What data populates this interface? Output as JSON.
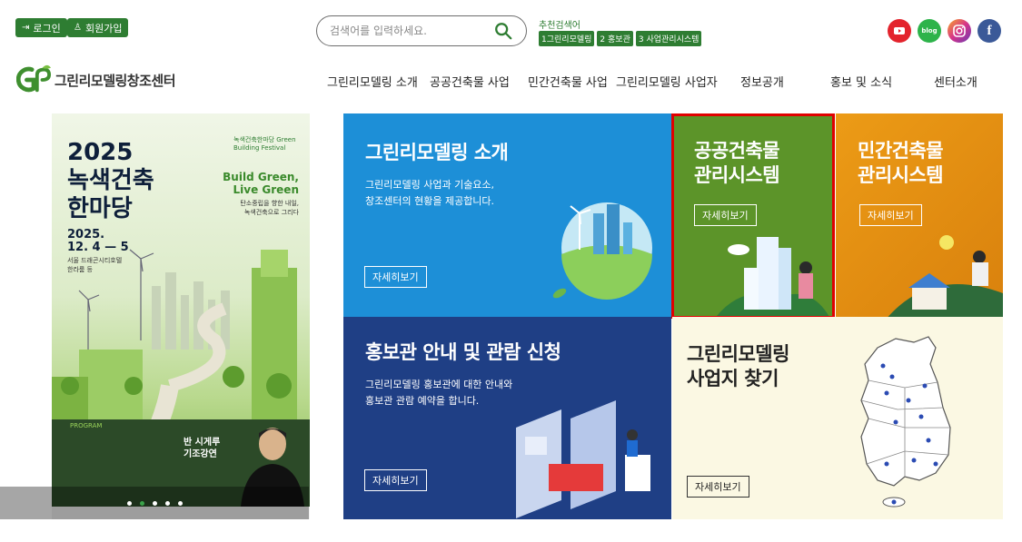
{
  "header": {
    "login_label": "로그인",
    "signup_label": "회원가입",
    "search": {
      "placeholder": "검색어를 입력하세요."
    },
    "recommended": {
      "label": "추천검색어",
      "tags": [
        "1그린리모델링",
        "2 홍보관",
        "3 사업관리시스템"
      ]
    },
    "social": [
      {
        "name": "youtube",
        "glyph": "▶",
        "color": "#e3232c"
      },
      {
        "name": "blog",
        "glyph": "blog",
        "color": "#2db34a"
      },
      {
        "name": "instagram",
        "glyph": "◎",
        "color": "#d6338a"
      },
      {
        "name": "facebook",
        "glyph": "f",
        "color": "#3b5998"
      }
    ]
  },
  "logo": {
    "text": "그린리모델링창조센터"
  },
  "nav": [
    "그린리모델링 소개",
    "공공건축물 사업",
    "민간건축물 사업",
    "그린리모델링 사업자",
    "정보공개",
    "홍보 및 소식",
    "센터소개"
  ],
  "poster": {
    "title_lines": [
      "2025",
      "녹색건축",
      "한마당"
    ],
    "fest_label": "녹색건축한마당 Green Building Festival",
    "slogan_lines": [
      "Build Green,",
      "Live Green"
    ],
    "sub_lines": [
      "탄소중립을 향한 내일,",
      "녹색건축으로 그리다"
    ],
    "date_lines": [
      "2025.",
      "12. 4 — 5"
    ],
    "venue_lines": [
      "서울 드래곤시티호텔",
      "한라룸 등"
    ],
    "program_label": "PROGRAM",
    "speaker_lines": [
      "반 시게루",
      "기조강연"
    ]
  },
  "pager": {
    "dots": 5,
    "active": 1
  },
  "tiles": {
    "intro": {
      "title": "그린리모델링 소개",
      "desc_lines": [
        "그린리모델링 사업과 기술요소,",
        "창조센터의 현황을 제공합니다."
      ],
      "button": "자세히보기"
    },
    "public": {
      "title_lines": [
        "공공건축물",
        "관리시스템"
      ],
      "button": "자세히보기"
    },
    "private": {
      "title_lines": [
        "민간건축물",
        "관리시스템"
      ],
      "button": "자세히보기"
    },
    "promo": {
      "title": "홍보관 안내 및 관람 신청",
      "desc_lines": [
        "그린리모델링 홍보관에 대한 안내와",
        "홍보관 관람 예약을 합니다."
      ],
      "button": "자세히보기"
    },
    "sites": {
      "title_lines": [
        "그린리모델링",
        "사업지 찾기"
      ],
      "button": "자세히보기"
    }
  }
}
